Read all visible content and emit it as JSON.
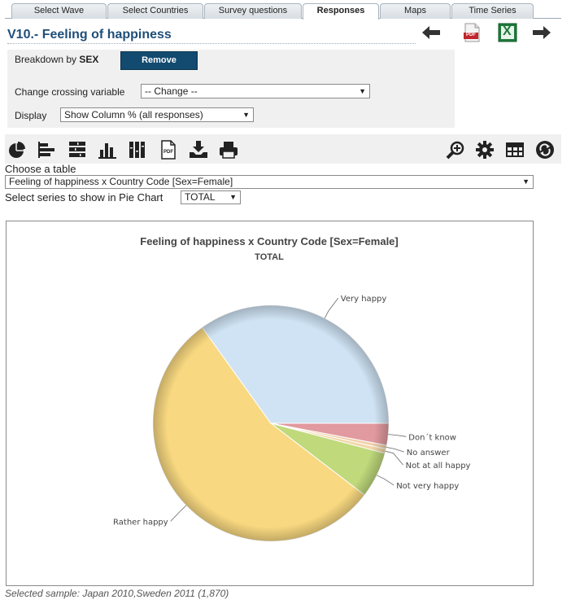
{
  "tabs": [
    {
      "label": "Select Wave"
    },
    {
      "label": "Select Countries"
    },
    {
      "label": "Survey questions"
    },
    {
      "label": "Responses"
    },
    {
      "label": "Maps"
    },
    {
      "label": "Time Series"
    }
  ],
  "active_tab": "Responses",
  "page": {
    "title": "V10.- Feeling of happiness"
  },
  "nav": {
    "back_icon": "arrow-left-icon",
    "pdf_icon": "pdf-file-icon",
    "pdf_label": "PDF",
    "excel_icon": "excel-file-icon",
    "excel_label": "X",
    "forward_icon": "arrow-right-icon"
  },
  "options": {
    "breakdown_label": "Breakdown by",
    "breakdown_value": "SEX",
    "remove_label": "Remove",
    "crossing_label": "Change crossing variable",
    "crossing_value": "-- Change --",
    "display_label": "Display",
    "display_value": "Show Column % (all responses)"
  },
  "toolbar": {
    "left_icons": [
      "pie-chart-icon",
      "horizontal-bar-chart-icon",
      "stacked-horizontal-bar-icon",
      "vertical-bar-chart-icon",
      "stacked-column-chart-icon",
      "pdf-export-icon",
      "download-icon",
      "print-icon"
    ],
    "pdf_label": "PDF",
    "right_icons": [
      "zoom-in-icon",
      "settings-gear-icon",
      "table-view-icon",
      "refresh-icon"
    ]
  },
  "table_select": {
    "label": "Choose a table",
    "value": "Feeling of happiness x Country Code [Sex=Female]"
  },
  "series_select": {
    "label": "Select series to show in Pie Chart",
    "value": "TOTAL"
  },
  "chart_data": {
    "type": "pie",
    "title": "Feeling of happiness x Country Code [Sex=Female]",
    "subtitle": "TOTAL",
    "start_angle_deg": 0,
    "slices": [
      {
        "label": "Don´t know",
        "value": 3.0,
        "color": "#e19a9f"
      },
      {
        "label": "No answer",
        "value": 0.5,
        "color": "#f0cfa8"
      },
      {
        "label": "Not at all happy",
        "value": 0.6,
        "color": "#f2d7a8"
      },
      {
        "label": "Not very happy",
        "value": 6.3,
        "color": "#bfd97b"
      },
      {
        "label": "Rather happy",
        "value": 54.7,
        "color": "#f8d880"
      },
      {
        "label": "Very happy",
        "value": 34.9,
        "color": "#cfe3f4"
      }
    ]
  },
  "footer": {
    "sample_text": "Selected sample: Japan 2010,Sweden 2011 (1,870)"
  }
}
